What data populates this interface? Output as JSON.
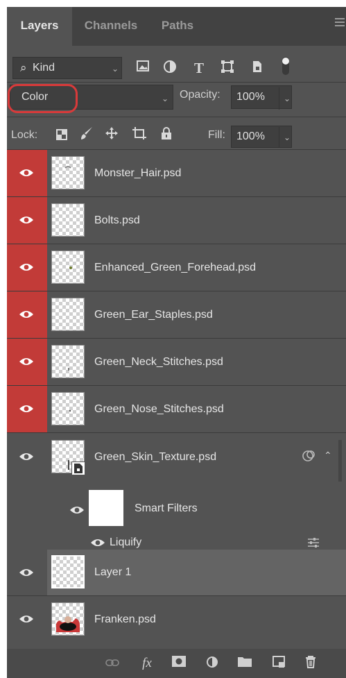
{
  "tabs": [
    {
      "label": "Layers",
      "active": true
    },
    {
      "label": "Channels",
      "active": false
    },
    {
      "label": "Paths",
      "active": false
    }
  ],
  "filter": {
    "kind_label": "Kind",
    "icons": [
      "image-filter-icon",
      "adjustment-filter-icon",
      "type-filter-icon",
      "shape-filter-icon",
      "smart-object-filter-icon",
      "filter-toggle-icon"
    ]
  },
  "blend_mode": {
    "value": "Color",
    "highlighted": true,
    "highlight_color": "#d93a3a"
  },
  "opacity": {
    "label": "Opacity:",
    "value": "100%"
  },
  "lock": {
    "label": "Lock:",
    "icons": [
      "lock-transparent-pixels-icon",
      "lock-image-pixels-icon",
      "lock-position-icon",
      "lock-artboard-icon",
      "lock-all-icon"
    ]
  },
  "fill": {
    "label": "Fill:",
    "value": "100%"
  },
  "layers": [
    {
      "name": "Monster_Hair.psd",
      "selected": true
    },
    {
      "name": "Bolts.psd",
      "selected": true
    },
    {
      "name": "Enhanced_Green_Forehead.psd",
      "selected": true
    },
    {
      "name": "Green_Ear_Staples.psd",
      "selected": true
    },
    {
      "name": "Green_Neck_Stitches.psd",
      "selected": true
    },
    {
      "name": "Green_Nose_Stitches.psd",
      "selected": true
    },
    {
      "name": "Green_Skin_Texture.psd",
      "selected": false,
      "smart_object": true
    },
    {
      "name": "Smart Filters",
      "kind": "smart-filters"
    },
    {
      "name": "Liquify",
      "kind": "filter"
    },
    {
      "name": "Layer 1",
      "selected": false,
      "active": true
    },
    {
      "name": "Franken.psd",
      "selected": false
    }
  ],
  "footer_icons": [
    "link-layers-icon",
    "fx-icon",
    "add-mask-icon",
    "adjustment-layer-icon",
    "new-group-icon",
    "new-layer-icon",
    "delete-icon"
  ],
  "colors": {
    "panel": "#535353",
    "selected_eye": "#c23b38",
    "active_row": "#646464"
  }
}
